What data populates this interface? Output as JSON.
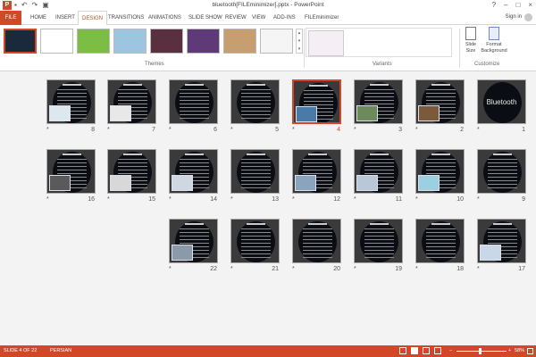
{
  "window": {
    "app_logo": "P",
    "title": "bluetooth[FILEminimizer].pptx - PowerPoint",
    "controls": [
      "?",
      "–",
      "□",
      "×"
    ]
  },
  "qat": [
    "save-icon",
    "undo-icon",
    "redo-icon",
    "start-presentation-icon"
  ],
  "tabs": [
    "FILE",
    "HOME",
    "INSERT",
    "DESIGN",
    "TRANSITIONS",
    "ANIMATIONS",
    "SLIDE SHOW",
    "REVIEW",
    "VIEW",
    "ADD-INS",
    "FILEminimizer"
  ],
  "active_tab": "DESIGN",
  "user": {
    "sign_in": "Sign in"
  },
  "ribbon": {
    "themes_label": "Themes",
    "variants_label": "Variants",
    "customize_label": "Customize",
    "slide_size_label": "Slide Size",
    "format_background_label": "Format Background",
    "themes": [
      {
        "name": "current",
        "color": "#1b2a3a"
      },
      {
        "name": "office-white",
        "color": "#ffffff"
      },
      {
        "name": "green",
        "color": "#7cbd45"
      },
      {
        "name": "blue-pattern",
        "color": "#9cc6e0"
      },
      {
        "name": "dark-pink",
        "color": "#5a3040"
      },
      {
        "name": "purple",
        "color": "#5e3a78"
      },
      {
        "name": "wood",
        "color": "#c79e6f"
      },
      {
        "name": "white-lines",
        "color": "#f5f5f5"
      }
    ]
  },
  "slides_row1": [
    {
      "num": "8",
      "pic": true,
      "picColor": "#dce7ee"
    },
    {
      "num": "7",
      "pic": true,
      "picColor": "#e8e8e8"
    },
    {
      "num": "6",
      "pic": false
    },
    {
      "num": "5",
      "pic": false
    },
    {
      "num": "4",
      "pic": true,
      "picColor": "#4a7aa8",
      "selected": true
    },
    {
      "num": "3",
      "pic": true,
      "picColor": "#6d8a5a"
    },
    {
      "num": "2",
      "pic": true,
      "picColor": "#7a5a3a"
    },
    {
      "num": "1",
      "pic": false,
      "bt": true
    }
  ],
  "slides_row2": [
    {
      "num": "16",
      "pic": true,
      "picColor": "#5a5a5a"
    },
    {
      "num": "15",
      "pic": true,
      "picColor": "#d8d8d8"
    },
    {
      "num": "14",
      "pic": true,
      "picColor": "#cfd8e0"
    },
    {
      "num": "13",
      "pic": false
    },
    {
      "num": "12",
      "pic": true,
      "picColor": "#8aa4c0"
    },
    {
      "num": "11",
      "pic": true,
      "picColor": "#b8c8d8"
    },
    {
      "num": "10",
      "pic": true,
      "picColor": "#9ad0e0"
    },
    {
      "num": "9",
      "pic": false
    }
  ],
  "slides_row3": [
    {
      "num": "22",
      "pic": true,
      "picColor": "#8a9aa8"
    },
    {
      "num": "21",
      "pic": false
    },
    {
      "num": "20",
      "pic": false
    },
    {
      "num": "19",
      "pic": false
    },
    {
      "num": "18",
      "pic": false
    },
    {
      "num": "17",
      "pic": true,
      "picColor": "#c8d8e8"
    }
  ],
  "slide1_text": "Bluetooth",
  "star": "*",
  "status": {
    "slide_info": "SLIDE 4 OF 22",
    "language": "PERSIAN",
    "zoom_minus": "−",
    "zoom_plus": "+",
    "zoom": "58%"
  }
}
